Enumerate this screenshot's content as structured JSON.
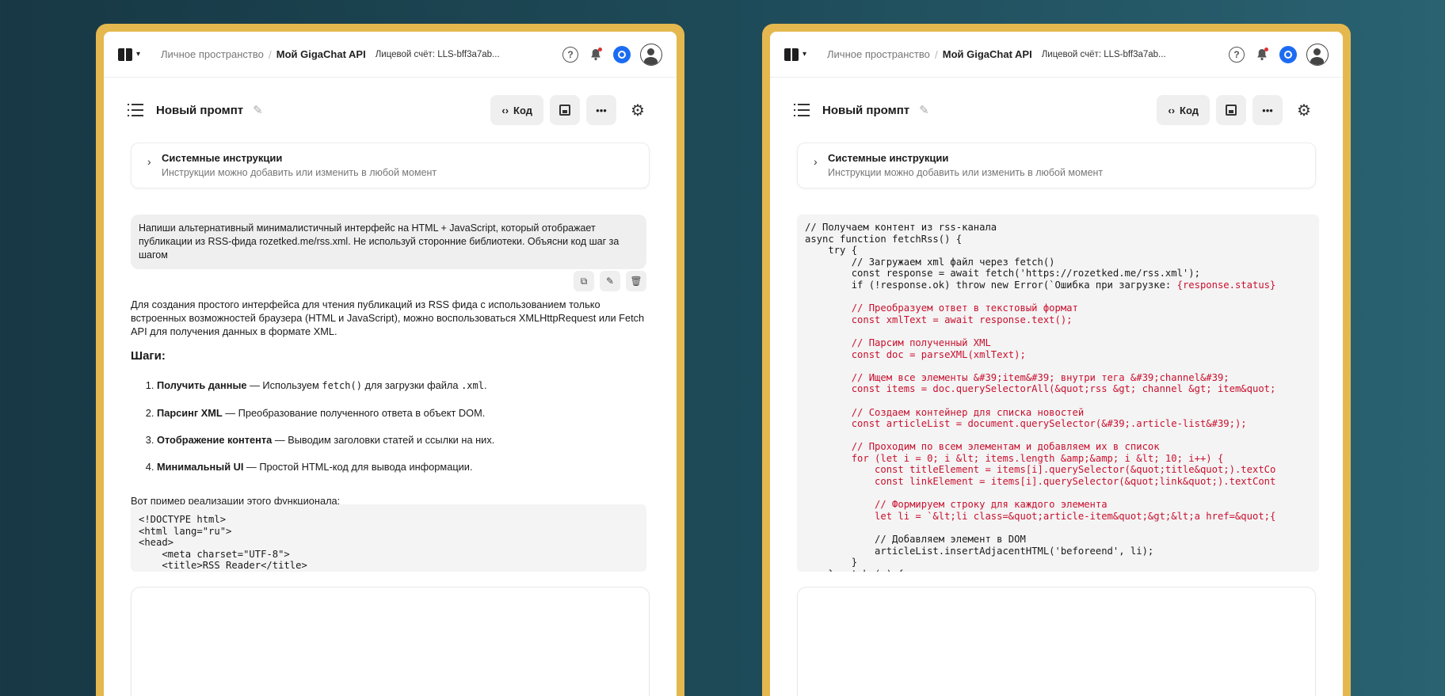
{
  "topbar": {
    "breadcrumb_root": "Личное пространство",
    "breadcrumb_sep": "/",
    "breadcrumb_current": "Мой GigaChat API",
    "account": "Лицевой счёт: LLS-bff3a7ab..."
  },
  "toolbar": {
    "title": "Новый промпт",
    "code_label": "Код"
  },
  "system": {
    "title": "Системные инструкции",
    "subtitle": "Инструкции можно добавить или изменить в любой момент"
  },
  "user_message": "Напиши альтернативный минималистичный интерфейс на HTML + JavaScript, который отображает публикации из RSS-фида rozetked.me/rss.xml. Не используй сторонние библиотеки. Объясни код шаг за шагом",
  "answer": {
    "intro": "Для создания простого интерфейса для чтения публикаций из RSS фида с использованием только встроенных возможностей браузера (HTML и JavaScript), можно воспользоваться XMLHttpRequest или Fetch API для получения данных в формате XML.",
    "steps_heading": "Шаги:",
    "steps": [
      {
        "title": "Получить данные",
        "dash": " — Используем ",
        "code1": "fetch()",
        "mid": " для загрузки файла ",
        "code2": ".xml",
        "end": "."
      },
      {
        "title": "Парсинг XML",
        "text": " — Преобразование полученного ответа в объект DOM."
      },
      {
        "title": "Отображение контента",
        "text": " — Выводим заголовки статей и ссылки на них."
      },
      {
        "title": "Минимальный UI",
        "text": " — Простой HTML-код для вывода информации."
      }
    ],
    "example_intro": "Вот пример реализации этого функционала:"
  },
  "left_code": [
    "<!DOCTYPE html>",
    "<html lang=\"ru\">",
    "<head>",
    "    <meta charset=\"UTF-8\">",
    "    <title>RSS Reader</title>"
  ],
  "right_code": [
    {
      "t": "// Получаем контент из rss-канала",
      "red": false
    },
    {
      "t": "async function fetchRss() {",
      "red": false
    },
    {
      "t": "    try {",
      "red": false
    },
    {
      "t": "        // Загружаем xml файл через fetch()",
      "red": false
    },
    {
      "t": "        const response = await fetch('https://rozetked.me/rss.xml');",
      "red": false
    },
    {
      "t": "        if (!response.ok) throw new Error(`Ошибка при загрузке: {response.status}",
      "red": false,
      "red_tail": "{response.status}"
    },
    {
      "t": "",
      "red": false
    },
    {
      "t": "        // Преобразуем ответ в текстовый формат",
      "red": true
    },
    {
      "t": "        const xmlText = await response.text();",
      "red": true
    },
    {
      "t": "",
      "red": false
    },
    {
      "t": "        // Парсим полученный XML",
      "red": true
    },
    {
      "t": "        const doc = parseXML(xmlText);",
      "red": true
    },
    {
      "t": "",
      "red": false
    },
    {
      "t": "        // Ищем все элементы &#39;item&#39; внутри тега &#39;channel&#39;",
      "red": true
    },
    {
      "t": "        const items = doc.querySelectorAll(&quot;rss &gt; channel &gt; item&quot;",
      "red": true
    },
    {
      "t": "",
      "red": false
    },
    {
      "t": "        // Создаем контейнер для списка новостей",
      "red": true
    },
    {
      "t": "        const articleList = document.querySelector(&#39;.article-list&#39;);",
      "red": true
    },
    {
      "t": "",
      "red": false
    },
    {
      "t": "        // Проходим по всем элементам и добавляем их в список",
      "red": true
    },
    {
      "t": "        for (let i = 0; i &lt; items.length &amp;&amp; i &lt; 10; i++) {",
      "red": true
    },
    {
      "t": "            const titleElement = items[i].querySelector(&quot;title&quot;).textCo",
      "red": true
    },
    {
      "t": "            const linkElement = items[i].querySelector(&quot;link&quot;).textCont",
      "red": true
    },
    {
      "t": "",
      "red": false
    },
    {
      "t": "            // Формируем строку для каждого элемента",
      "red": true
    },
    {
      "t": "            let li = `&lt;li class=&quot;article-item&quot;&gt;&lt;a href=&quot;{",
      "red": true
    },
    {
      "t": "",
      "red": false
    },
    {
      "t": "            // Добавляем элемент в DOM",
      "red": false
    },
    {
      "t": "            articleList.insertAdjacentHTML('beforeend', li);",
      "red": false
    },
    {
      "t": "        }",
      "red": false
    },
    {
      "t": "    } catch (e) {",
      "red": false
    }
  ],
  "colors": {
    "frame": "#e4b84e",
    "accent": "#1b6cf2",
    "code_red": "#c8102e"
  },
  "icons": [
    "app-switcher-icon",
    "help-icon",
    "bell-icon",
    "assistant-icon",
    "avatar-icon",
    "list-icon",
    "pencil-icon",
    "code-icon",
    "save-icon",
    "more-icon",
    "gear-icon",
    "chevron-right-icon",
    "copy-icon",
    "edit-icon",
    "trash-icon"
  ]
}
